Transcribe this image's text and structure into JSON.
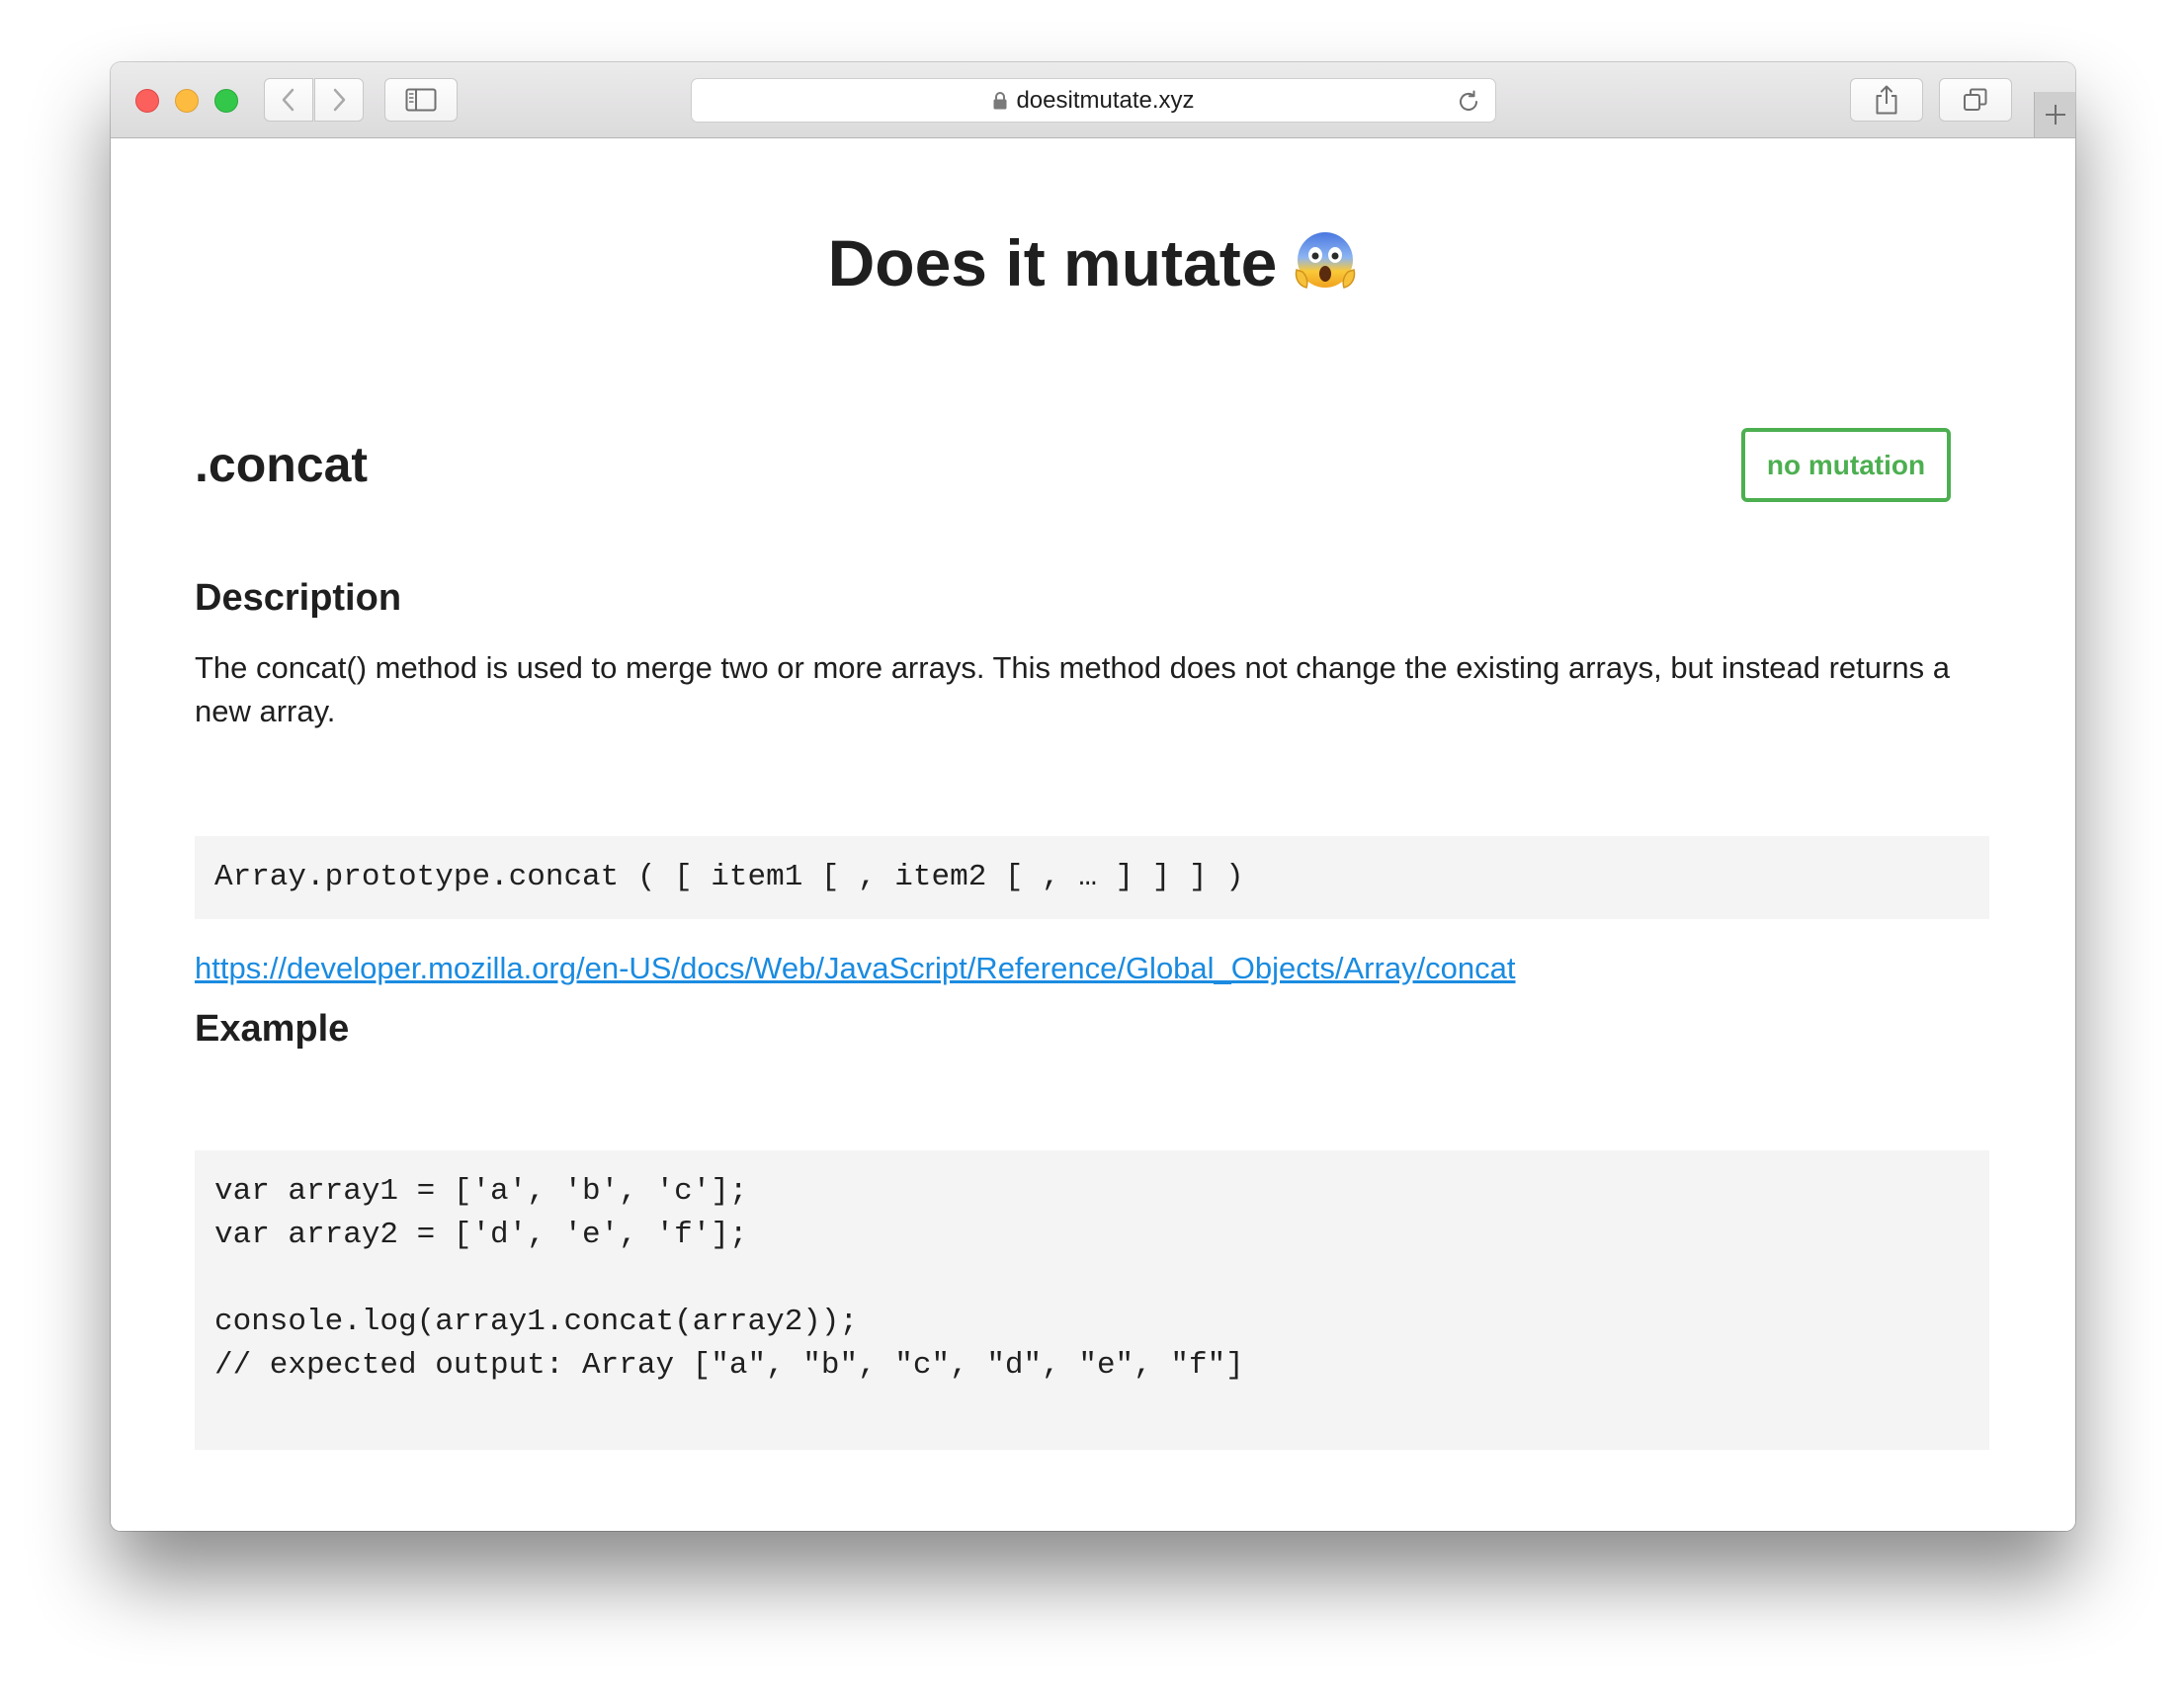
{
  "browser": {
    "url": "doesitmutate.xyz",
    "icons": {
      "back": "chevron-left-icon",
      "forward": "chevron-right-icon",
      "sidebar": "sidebar-icon",
      "lock": "lock-icon",
      "reload": "reload-icon",
      "share": "share-icon",
      "tabs": "tabs-overview-icon",
      "new_tab": "plus-icon"
    }
  },
  "page": {
    "title": "Does it mutate",
    "title_emoji": "face-screaming-in-fear-icon",
    "method": ".concat",
    "badge": "no mutation",
    "badge_color": "#4caf50",
    "description_heading": "Description",
    "description": "The concat() method is used to merge two or more arrays. This method does not change the existing arrays, but instead returns a new array.",
    "signature": "Array.prototype.concat ( [ item1 [ , item2 [ , … ] ] ] )",
    "link": "https://developer.mozilla.org/en-US/docs/Web/JavaScript/Reference/Global_Objects/Array/concat",
    "link_color": "#1a8be0",
    "example_heading": "Example",
    "example_lines": [
      "var array1 = ['a', 'b', 'c'];",
      "var array2 = ['d', 'e', 'f'];",
      "",
      "console.log(array1.concat(array2));",
      "// expected output: Array [\"a\", \"b\", \"c\", \"d\", \"e\", \"f\"]"
    ]
  }
}
